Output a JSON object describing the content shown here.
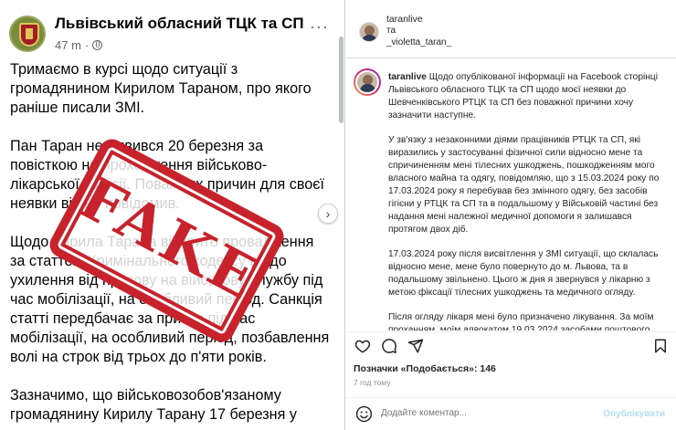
{
  "facebook_post": {
    "author": "Львівський обласний ТЦК та СП",
    "time": "47 m",
    "time_separator": "·",
    "more_label": "···",
    "next_label": "›",
    "paragraphs": [
      "Тримаємо в курсі щодо ситуації з громадянином Кирилом Тараном, про якого раніше писали ЗМІ.",
      "Пан Таран не з'явився 20 березня за повісткою на проходження військово-лікарської комісії. Поважних причин для своєї неявки він не повідомив.",
      "Щодо Кирила Тарана відкрито провадження за статтею Кримінального кодексу щодо ухилення від призову на військову службу під час мобілізації, на особливий період. Санкція статті передбачає за призов під час мобілізації, на особливий період, позбавлення волі на строк від трьох до п'яти років.",
      "Зазначимо, що військовозобов'язаному громадянину Кирилу Тарану 17 березня у"
    ]
  },
  "stamp": {
    "text": "FAKE",
    "color": "#c8232c"
  },
  "instagram": {
    "header": {
      "user1": "taranlive",
      "and": "та",
      "user2": "_violetta_taran_"
    },
    "caption": {
      "username": "taranlive",
      "paragraphs": [
        "Щодо опублікованої інформації на Facebook сторінці Львівського обласного ТЦК та СП щодо моєї неявки до Шевченківського РТЦК та СП без поважної причини хочу зазначити наступне.",
        "У зв'язку з незаконними діями працівників РТЦК та СП, які виразились у застосуванні фізичної сили відносно мене та спричиненням мені тілесних ушкоджень, пошкодженням мого власного майна та одягу, повідомляю, що з 15.03.2024 року по 17.03.2024 року я перебував без змінного одягу, без засобів гігієни у РТЦК та СП та в подальшому у Військовій частині без надання мені належної медичної допомоги я залишався протягом двох діб.",
        "17.03.2024 року після висвітлення у ЗМІ ситуації, що склалась відносно мене, мене було повернуто до м. Львова, та в подальшому звільнено. Цього ж дня я звернувся у лікарню з метою фіксації тілесних ушкоджень та медичного огляду.",
        "Після огляду лікаря мені було призначено лікування. За моїм проханням, моїм адвокатом 19.03.2024 засобами поштового"
      ]
    },
    "likes": "Позначки «Подобається»: 146",
    "time_ago": "7 год тому",
    "comment_placeholder": "Додайте коментар...",
    "publish_label": "Опублікувати",
    "icons": [
      "heart-icon",
      "comment-icon",
      "share-icon",
      "bookmark-icon",
      "smile-icon"
    ]
  }
}
